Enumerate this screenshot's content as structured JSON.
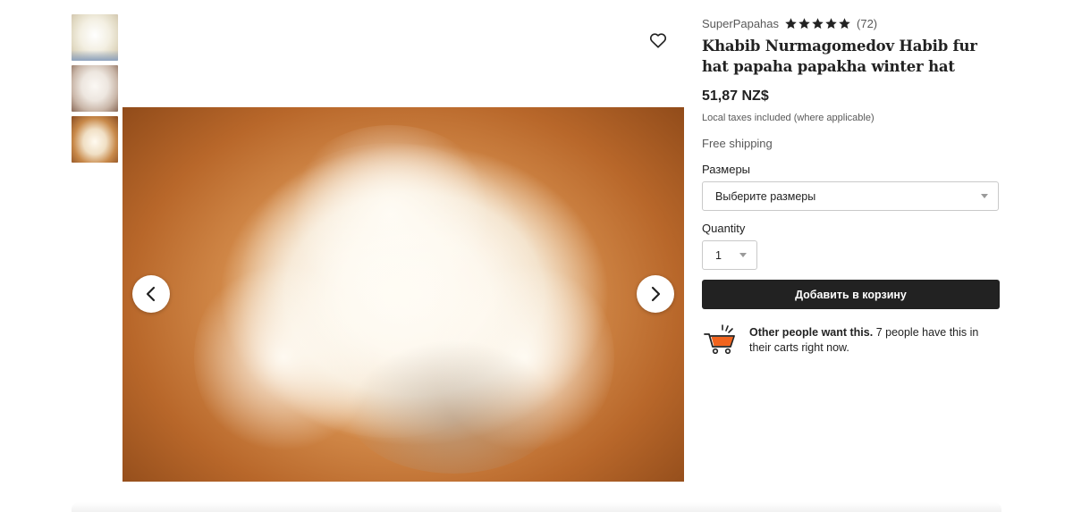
{
  "thumbnails": [
    {
      "name": "thumbnail-1"
    },
    {
      "name": "thumbnail-2"
    },
    {
      "name": "thumbnail-3"
    }
  ],
  "gallery": {
    "prev_icon": "chevron-left-icon",
    "next_icon": "chevron-right-icon",
    "favorite_icon": "heart-outline-icon"
  },
  "shop": {
    "name": "SuperPapahas",
    "rating": 5,
    "reviews": "(72)"
  },
  "product": {
    "title": "Khabib Nurmagomedov Habib fur hat papaha papakha winter hat",
    "price": "51,87 NZ$",
    "tax_note": "Local taxes included (where applicable)",
    "shipping": "Free shipping"
  },
  "options": {
    "size_label": "Размеры",
    "size_value": "Выберите размеры",
    "quantity_label": "Quantity",
    "quantity_value": "1"
  },
  "cart": {
    "add_label": "Добавить в корзину"
  },
  "demand": {
    "bold": "Other people want this.",
    "text": " 7 people have this in their carts right now.",
    "icon": "shopping-cart-icon"
  },
  "colors": {
    "button": "#222222",
    "cart_icon": "#f1641e",
    "star": "#222222"
  }
}
